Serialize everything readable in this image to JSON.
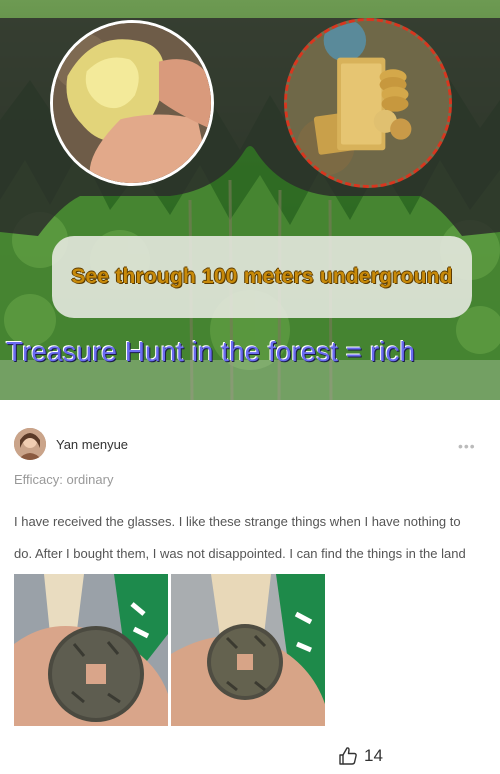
{
  "banner": {
    "tagline": "See through 100 meters underground",
    "headline": "Treasure Hunt in the forest = rich",
    "colors": {
      "tagline": "#c88a0a",
      "headline": "#6a6cf0",
      "lens_dash": "#d8361f"
    }
  },
  "review": {
    "username": "Yan menyue",
    "efficacy_label": "Efficacy: ordinary",
    "lines": [
      "I have received the glasses. I like these strange things when I have nothing to",
      "do. After I bought them, I was not disappointed. I can find the things in the land"
    ],
    "more_icon": "more-dots-icon",
    "like_icon": "thumbs-up-icon",
    "like_count": "14"
  }
}
